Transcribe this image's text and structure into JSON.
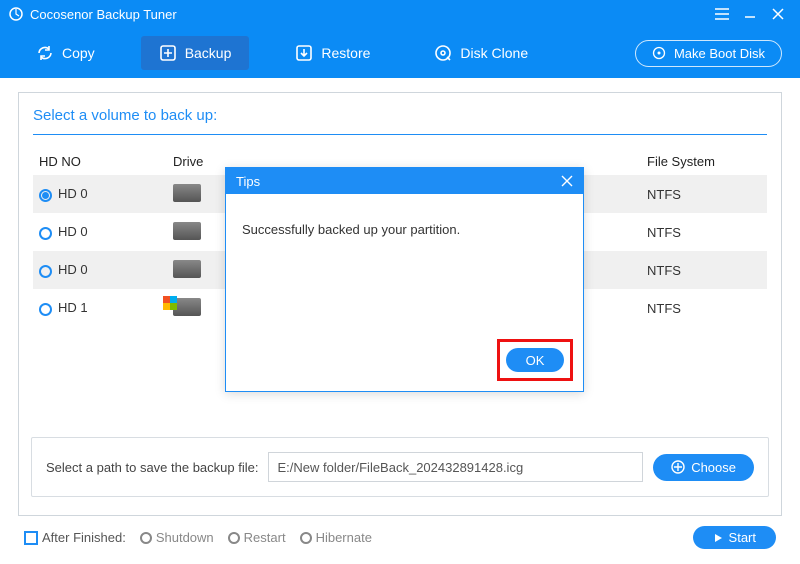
{
  "titlebar": {
    "title": "Cocosenor Backup Tuner"
  },
  "toolbar": {
    "copy": "Copy",
    "backup": "Backup",
    "restore": "Restore",
    "diskclone": "Disk Clone",
    "bootdisk": "Make Boot Disk"
  },
  "panel": {
    "heading": "Select a volume to back up:",
    "columns": {
      "hdno": "HD NO",
      "drive": "Drive",
      "fs": "File System"
    },
    "rows": [
      {
        "hd": "HD 0",
        "fs": "NTFS",
        "selected": true,
        "win": false
      },
      {
        "hd": "HD 0",
        "fs": "NTFS",
        "selected": false,
        "win": false
      },
      {
        "hd": "HD 0",
        "fs": "NTFS",
        "selected": false,
        "win": false
      },
      {
        "hd": "HD 1",
        "fs": "NTFS",
        "selected": false,
        "win": true
      }
    ],
    "pathlabel": "Select a path to save the backup file:",
    "pathvalue": "E:/New folder/FileBack_202432891428.icg",
    "choose": "Choose"
  },
  "footer": {
    "afterlabel": "After Finished:",
    "shutdown": "Shutdown",
    "restart": "Restart",
    "hibernate": "Hibernate",
    "start": "Start"
  },
  "dialog": {
    "title": "Tips",
    "message": "Successfully backed up your partition.",
    "ok": "OK"
  }
}
